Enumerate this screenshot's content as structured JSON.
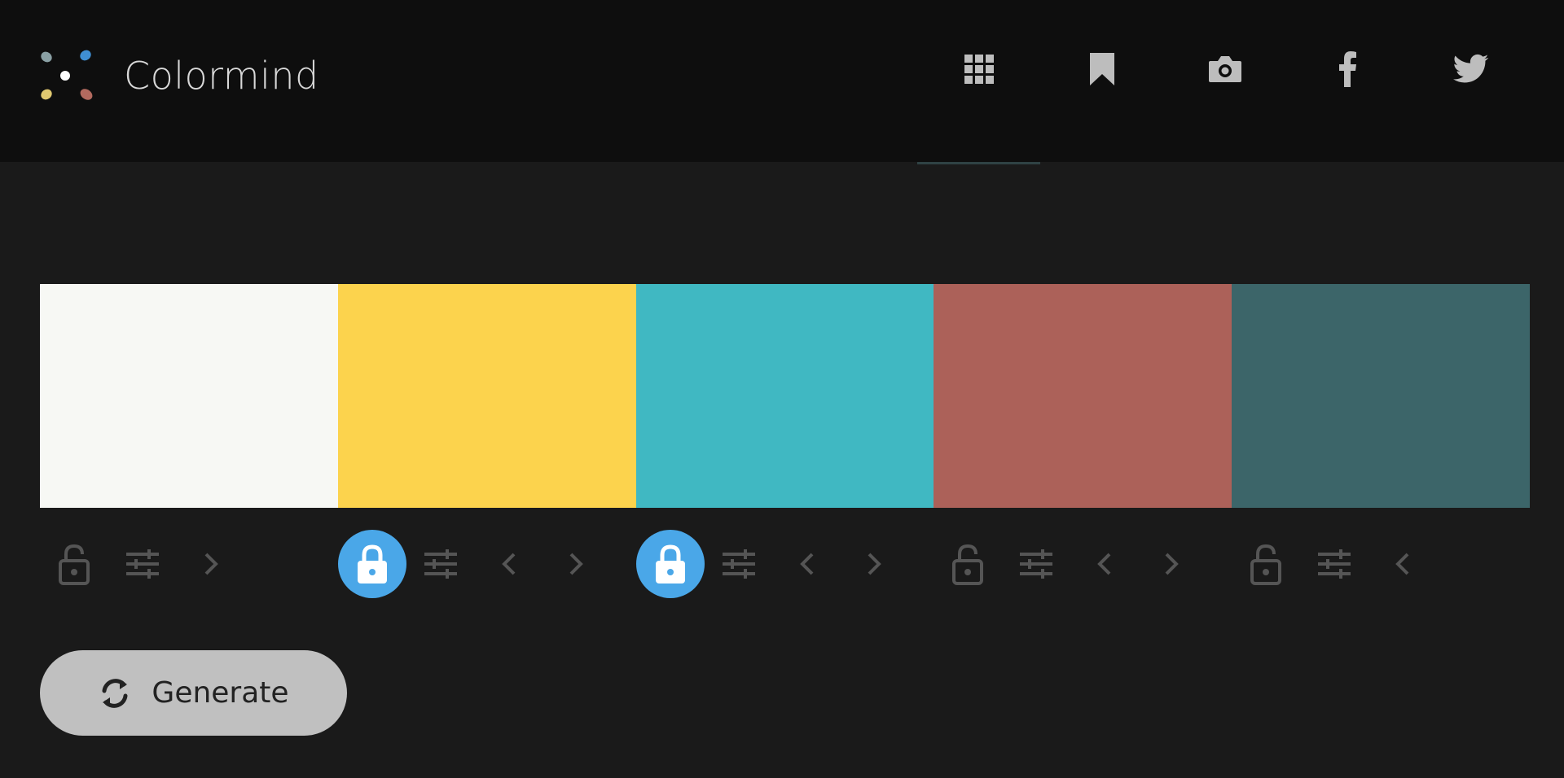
{
  "brand": {
    "name": "Colormind",
    "logo_dot_colors": [
      "#8aa0a4",
      "#3f8fd4",
      "#ffffff",
      "#e0c870",
      "#b36a5f"
    ]
  },
  "nav": {
    "items": [
      {
        "name": "grid-icon",
        "active": true
      },
      {
        "name": "bookmark-icon",
        "active": false
      },
      {
        "name": "camera-icon",
        "active": false
      },
      {
        "name": "facebook-icon",
        "active": false
      },
      {
        "name": "twitter-icon",
        "active": false
      }
    ],
    "icon_color": "#bdbdbd"
  },
  "palette": {
    "swatches": [
      {
        "color": "#f7f8f4",
        "locked": false,
        "has_prev": false,
        "has_next": true
      },
      {
        "color": "#fcd34d",
        "locked": true,
        "has_prev": true,
        "has_next": true
      },
      {
        "color": "#40b8c2",
        "locked": true,
        "has_prev": true,
        "has_next": true
      },
      {
        "color": "#ac6159",
        "locked": false,
        "has_prev": true,
        "has_next": true
      },
      {
        "color": "#3c6569",
        "locked": false,
        "has_prev": true,
        "has_next": false
      }
    ],
    "control_icon_color": "#555555",
    "lock_active_color": "#4aa7e8"
  },
  "generate": {
    "label": "Generate"
  }
}
